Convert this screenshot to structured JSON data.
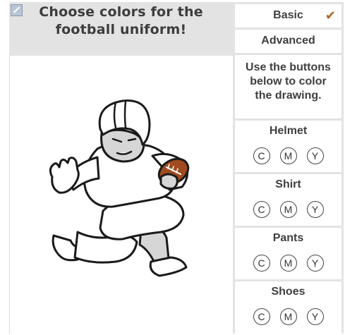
{
  "header": {
    "title_line1": "Choose colors for the",
    "title_line2": "football uniform!"
  },
  "tabs": {
    "basic": "Basic",
    "advanced": "Advanced",
    "selected": "Basic",
    "check_glyph": "✔"
  },
  "instructions": {
    "line1": "Use the buttons",
    "line2": "below to color",
    "line3": "the drawing."
  },
  "sections": [
    {
      "title": "Helmet",
      "buttons": [
        "C",
        "M",
        "Y"
      ]
    },
    {
      "title": "Shirt",
      "buttons": [
        "C",
        "M",
        "Y"
      ]
    },
    {
      "title": "Pants",
      "buttons": [
        "C",
        "M",
        "Y"
      ]
    },
    {
      "title": "Shoes",
      "buttons": [
        "C",
        "M",
        "Y"
      ]
    }
  ],
  "colors": {
    "ball": "#a04a1f",
    "check": "#b5651d",
    "panel_bg": "#e3e3e3"
  }
}
